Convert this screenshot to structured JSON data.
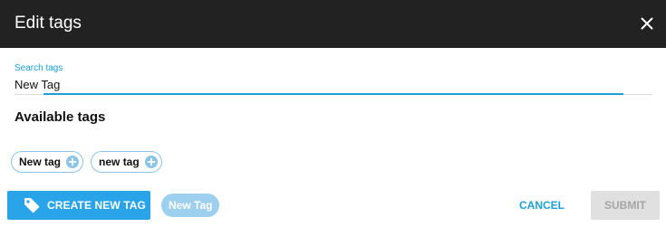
{
  "dialog": {
    "title": "Edit tags"
  },
  "search": {
    "label": "Search tags",
    "value": "New Tag"
  },
  "available_tags": {
    "heading": "Available tags",
    "items": [
      {
        "label": "New tag"
      },
      {
        "label": "new tag"
      }
    ]
  },
  "footer": {
    "create_label": "CREATE NEW TAG",
    "preview_label": "New Tag",
    "cancel_label": "CANCEL",
    "submit_label": "SUBMIT"
  },
  "icons": {
    "close": "close-icon",
    "add": "plus-circle-icon",
    "tag": "tag-icon"
  },
  "colors": {
    "header_bg": "#222222",
    "accent": "#1a9fd9",
    "create_button": "#2aa4e8",
    "chip_border": "#8cc4e8",
    "preview_chip": "#9dd0ee",
    "disabled_button": "#e0e0e0"
  }
}
